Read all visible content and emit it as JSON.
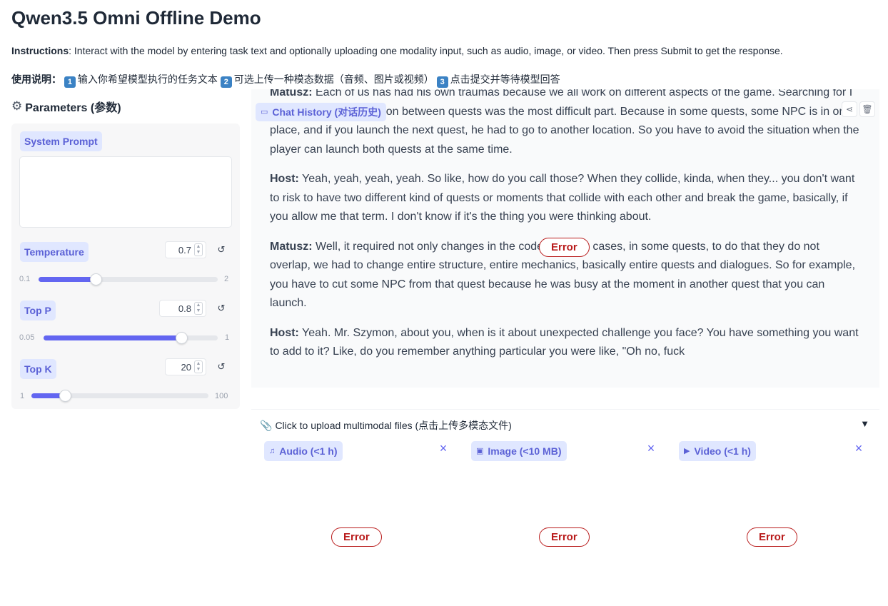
{
  "app": {
    "title": "Qwen3.5 Omni Offline Demo",
    "instructions_label": "Instructions",
    "instructions_text": ": Interact with the model by entering task text and optionally uploading one modality input, such as audio, image, or video. Then press Submit to get the response.",
    "instructions_zh_label": "使用说明：",
    "instructions_zh_steps": [
      {
        "num": "1",
        "text": "输入你希望模型执行的任务文本"
      },
      {
        "num": "2",
        "text": "可选上传一种模态数据（音频、图片或视频）"
      },
      {
        "num": "3",
        "text": "点击提交并等待模型回答"
      }
    ]
  },
  "params": {
    "header": "Parameters (参数)",
    "system_prompt_label": "System Prompt",
    "system_prompt_value": "",
    "temperature": {
      "label": "Temperature",
      "value": "0.7",
      "min": "0.1",
      "max": "2",
      "fraction": 0.32
    },
    "top_p": {
      "label": "Top P",
      "value": "0.8",
      "min": "0.05",
      "max": "1",
      "fraction": 0.79
    },
    "top_k": {
      "label": "Top K",
      "value": "20",
      "min": "1",
      "max": "100",
      "fraction": 0.19
    },
    "reset_icon": "↺"
  },
  "chat": {
    "label": "Chat History (对话历史)",
    "messages": [
      {
        "speaker": "Matusz:",
        "text": " Each of us has had his own traumas because we all work on different aspects of the game. Searching for I think that synchronization between quests was the most difficult part. Because in some quests, some NPC is in one place, and if you launch the next quest, he had to go to another location. So you have to avoid the situation when the player can launch both quests at the same time."
      },
      {
        "speaker": "Host:",
        "text": " Yeah, yeah, yeah, yeah. So like, how do you call those? When they collide, kinda, when they... you don't want to risk to have two different kind of quests or moments that collide with each other and break the game, basically, if you allow me that term. I don't know if it's the thing you were thinking about."
      },
      {
        "speaker": "Matusz:",
        "text": " Well, it required not only changes in the code, in some cases, in some quests, to do that they do not overlap, we had to change entire structure, entire mechanics, basically entire quests and dialogues. So for example, you have to cut some NPC from that quest because he was busy at the moment in another quest that you can launch."
      },
      {
        "speaker": "Host:",
        "text": " Yeah. Mr. Szymon, about you, when is it about unexpected challenge you face? You have something you want to add to it? Like, do you remember anything particular you were like, \"Oh no, fuck"
      }
    ],
    "error_label": "Error"
  },
  "upload": {
    "header": "Click to upload multimodal files (点击上传多模态文件)",
    "caret": "▼",
    "audio_label": "Audio (<1 h)",
    "image_label": "Image (<10 MB)",
    "video_label": "Video (<1 h)",
    "error_label": "Error",
    "close": "×"
  }
}
